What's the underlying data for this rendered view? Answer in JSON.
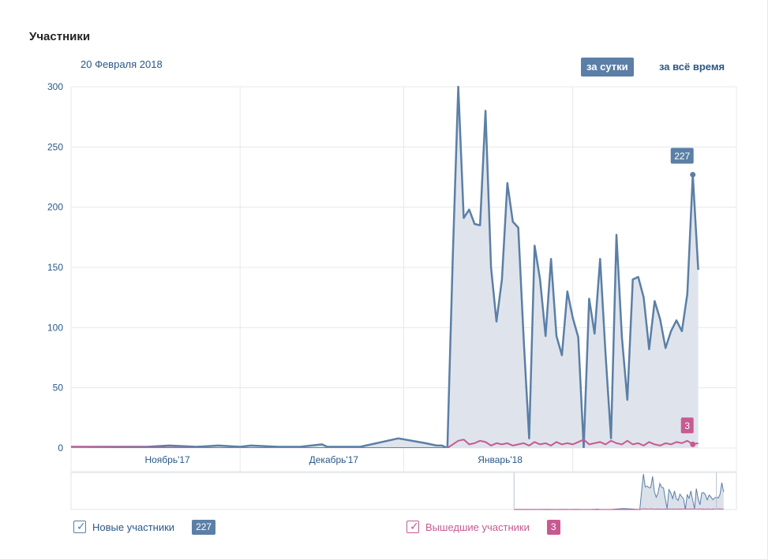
{
  "panel": {
    "title": "Участники",
    "date": "20 Февраля 2018",
    "period_day": "за сутки",
    "period_all": "за всё время"
  },
  "colors": {
    "new": "#5b7fa6",
    "new_fill": "#dbe1ea",
    "left": "#c75a92",
    "grid": "#e7e8ec",
    "axis_text": "#2a5885"
  },
  "legend": {
    "new_label": "Новые участники",
    "new_value": "227",
    "left_label": "Вышедшие участники",
    "left_value": "3"
  },
  "chart_data": {
    "type": "area",
    "ylim": [
      0,
      300
    ],
    "y_ticks": [
      "0",
      "50",
      "100",
      "150",
      "200",
      "250",
      "300"
    ],
    "x_labels": [
      "Ноябрь'17",
      "Декабрь'17",
      "Январь'18"
    ],
    "x_range": [
      "2017-10-21",
      "2018-02-20"
    ],
    "grid": true,
    "series": [
      {
        "name": "Новые участники",
        "current_label": "227",
        "points": [
          [
            "2017-10-21",
            1
          ],
          [
            "2017-10-25",
            1
          ],
          [
            "2017-10-30",
            1
          ],
          [
            "2017-11-04",
            1
          ],
          [
            "2017-11-08",
            2
          ],
          [
            "2017-11-13",
            1
          ],
          [
            "2017-11-17",
            2
          ],
          [
            "2017-11-21",
            1
          ],
          [
            "2017-11-23",
            2
          ],
          [
            "2017-11-28",
            1
          ],
          [
            "2017-12-02",
            1
          ],
          [
            "2017-12-06",
            3
          ],
          [
            "2017-12-07",
            1
          ],
          [
            "2017-12-13",
            1
          ],
          [
            "2017-12-20",
            8
          ],
          [
            "2017-12-25",
            4
          ],
          [
            "2017-12-27",
            2
          ],
          [
            "2017-12-28",
            2
          ],
          [
            "2017-12-29",
            0
          ],
          [
            "2017-12-30",
            160
          ],
          [
            "2017-12-31",
            300
          ],
          [
            "2018-01-01",
            191
          ],
          [
            "2018-01-02",
            198
          ],
          [
            "2018-01-03",
            186
          ],
          [
            "2018-01-04",
            185
          ],
          [
            "2018-01-05",
            280
          ],
          [
            "2018-01-06",
            150
          ],
          [
            "2018-01-07",
            105
          ],
          [
            "2018-01-08",
            140
          ],
          [
            "2018-01-09",
            220
          ],
          [
            "2018-01-10",
            188
          ],
          [
            "2018-01-11",
            183
          ],
          [
            "2018-01-12",
            90
          ],
          [
            "2018-01-13",
            8
          ],
          [
            "2018-01-14",
            168
          ],
          [
            "2018-01-15",
            140
          ],
          [
            "2018-01-16",
            93
          ],
          [
            "2018-01-17",
            157
          ],
          [
            "2018-01-18",
            93
          ],
          [
            "2018-01-19",
            77
          ],
          [
            "2018-01-20",
            130
          ],
          [
            "2018-01-21",
            108
          ],
          [
            "2018-01-22",
            92
          ],
          [
            "2018-01-23",
            0
          ],
          [
            "2018-01-24",
            124
          ],
          [
            "2018-01-25",
            95
          ],
          [
            "2018-01-26",
            157
          ],
          [
            "2018-01-27",
            78
          ],
          [
            "2018-01-28",
            8
          ],
          [
            "2018-01-29",
            177
          ],
          [
            "2018-01-30",
            92
          ],
          [
            "2018-01-31",
            40
          ],
          [
            "2018-02-01",
            140
          ],
          [
            "2018-02-02",
            142
          ],
          [
            "2018-02-03",
            125
          ],
          [
            "2018-02-04",
            82
          ],
          [
            "2018-02-05",
            122
          ],
          [
            "2018-02-06",
            107
          ],
          [
            "2018-02-07",
            83
          ],
          [
            "2018-02-08",
            97
          ],
          [
            "2018-02-09",
            106
          ],
          [
            "2018-02-10",
            97
          ],
          [
            "2018-02-11",
            128
          ],
          [
            "2018-02-12",
            227
          ],
          [
            "2018-02-13",
            148
          ]
        ]
      },
      {
        "name": "Вышедшие участники",
        "current_label": "3",
        "points": [
          [
            "2017-10-21",
            1
          ],
          [
            "2017-11-15",
            0
          ],
          [
            "2017-12-15",
            0
          ],
          [
            "2017-12-29",
            0
          ],
          [
            "2017-12-30",
            3
          ],
          [
            "2017-12-31",
            6
          ],
          [
            "2018-01-01",
            7
          ],
          [
            "2018-01-02",
            3
          ],
          [
            "2018-01-03",
            4
          ],
          [
            "2018-01-04",
            6
          ],
          [
            "2018-01-05",
            5
          ],
          [
            "2018-01-06",
            2
          ],
          [
            "2018-01-07",
            4
          ],
          [
            "2018-01-08",
            3
          ],
          [
            "2018-01-09",
            4
          ],
          [
            "2018-01-10",
            2
          ],
          [
            "2018-01-11",
            3
          ],
          [
            "2018-01-12",
            4
          ],
          [
            "2018-01-13",
            2
          ],
          [
            "2018-01-14",
            5
          ],
          [
            "2018-01-15",
            3
          ],
          [
            "2018-01-16",
            4
          ],
          [
            "2018-01-17",
            2
          ],
          [
            "2018-01-18",
            5
          ],
          [
            "2018-01-19",
            3
          ],
          [
            "2018-01-20",
            4
          ],
          [
            "2018-01-21",
            3
          ],
          [
            "2018-01-22",
            5
          ],
          [
            "2018-01-23",
            7
          ],
          [
            "2018-01-24",
            3
          ],
          [
            "2018-01-25",
            4
          ],
          [
            "2018-01-26",
            5
          ],
          [
            "2018-01-27",
            3
          ],
          [
            "2018-01-28",
            6
          ],
          [
            "2018-01-29",
            4
          ],
          [
            "2018-01-30",
            3
          ],
          [
            "2018-01-31",
            6
          ],
          [
            "2018-02-01",
            3
          ],
          [
            "2018-02-02",
            4
          ],
          [
            "2018-02-03",
            2
          ],
          [
            "2018-02-04",
            5
          ],
          [
            "2018-02-05",
            3
          ],
          [
            "2018-02-06",
            2
          ],
          [
            "2018-02-07",
            4
          ],
          [
            "2018-02-08",
            3
          ],
          [
            "2018-02-09",
            5
          ],
          [
            "2018-02-10",
            4
          ],
          [
            "2018-02-11",
            6
          ],
          [
            "2018-02-12",
            3
          ],
          [
            "2018-02-13",
            4
          ]
        ]
      }
    ]
  }
}
